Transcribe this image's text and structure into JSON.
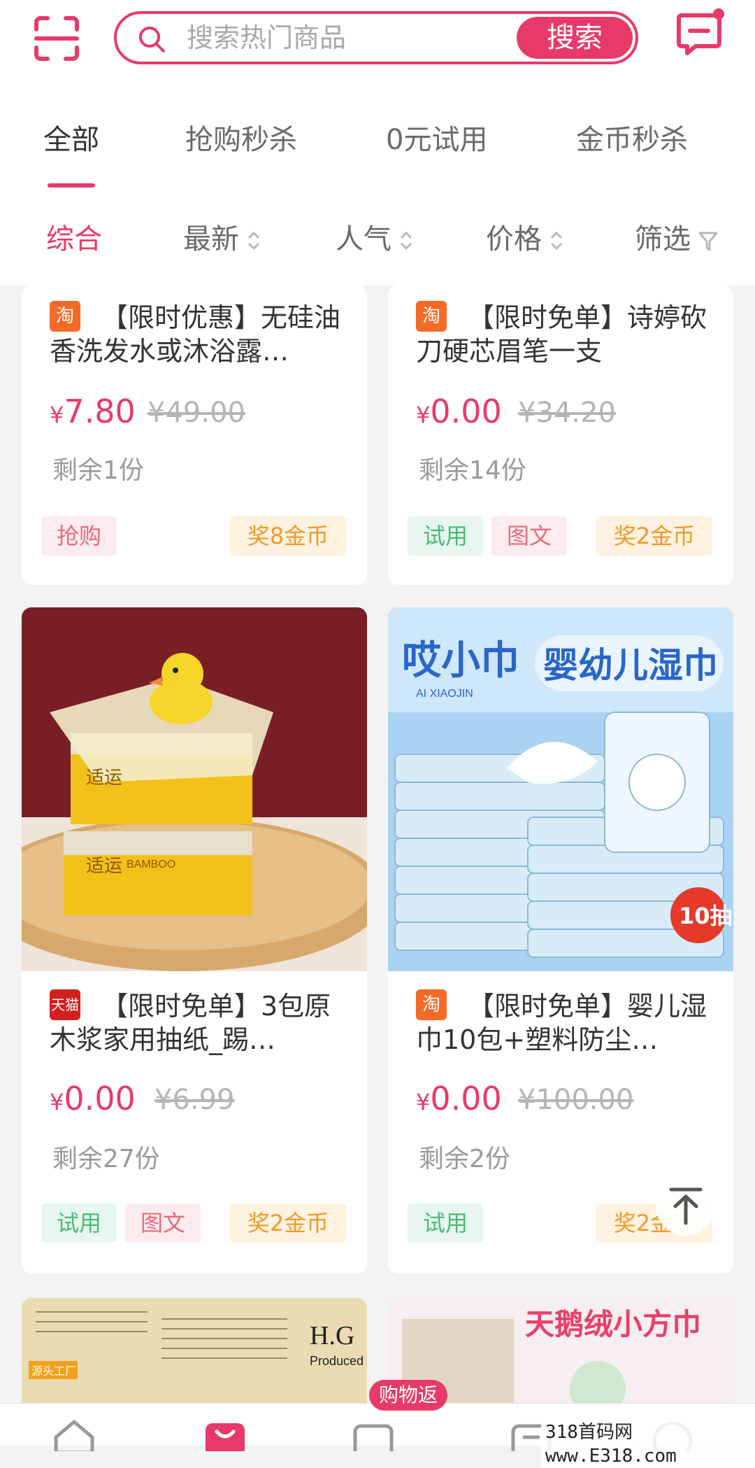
{
  "header": {
    "search_placeholder": "搜索热门商品",
    "search_button": "搜索"
  },
  "tabs": [
    {
      "label": "全部",
      "active": true
    },
    {
      "label": "抢购秒杀",
      "active": false
    },
    {
      "label": "0元试用",
      "active": false
    },
    {
      "label": "金币秒杀",
      "active": false
    }
  ],
  "sort": [
    {
      "label": "综合",
      "active": true
    },
    {
      "label": "最新",
      "active": false
    },
    {
      "label": "人气",
      "active": false
    },
    {
      "label": "价格",
      "active": false
    },
    {
      "label": "筛选",
      "active": false
    }
  ],
  "products": [
    {
      "platform": "淘",
      "title": "【限时优惠】无硅油香洗发水或沐浴露…",
      "price_symbol": "¥",
      "price": "7.80",
      "original_price": "¥49.00",
      "remaining": "剩余1份",
      "tags": [
        "抢购"
      ],
      "reward": "奖8金币"
    },
    {
      "platform": "淘",
      "title": "【限时免单】诗婷砍刀硬芯眉笔一支",
      "price_symbol": "¥",
      "price": "0.00",
      "original_price": "¥34.20",
      "remaining": "剩余14份",
      "tags": [
        "试用",
        "图文"
      ],
      "reward": "奖2金币"
    },
    {
      "platform": "天猫",
      "title": "【限时免单】3包原木浆家用抽纸_踢…",
      "price_symbol": "¥",
      "price": "0.00",
      "original_price": "¥6.99",
      "remaining": "剩余27份",
      "tags": [
        "试用",
        "图文"
      ],
      "reward": "奖2金币",
      "image_text": [
        "适运",
        "BAMBOO"
      ]
    },
    {
      "platform": "淘",
      "title": "【限时免单】婴儿湿巾10包+塑料防尘…",
      "price_symbol": "¥",
      "price": "0.00",
      "original_price": "¥100.00",
      "remaining": "剩余2份",
      "tags": [
        "试用"
      ],
      "reward": "奖2金币",
      "image_text": [
        "哎小巾",
        "AI XIAOJIN",
        "婴幼儿湿巾",
        "10抽"
      ]
    }
  ],
  "partial_cards": [
    {
      "image_text": [
        "H.G",
        "Produced by",
        "源头工厂"
      ]
    },
    {
      "image_text": [
        "天鹅绒小方巾"
      ]
    }
  ],
  "bottom_nav": {
    "badge": "购物返"
  },
  "watermark": "318首码网 www.E318.com"
}
